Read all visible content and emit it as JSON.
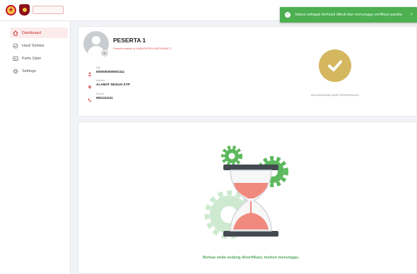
{
  "toast": {
    "message": "Status sebagai berhasil diikuti dan menunggu verifikasi panitia",
    "close": "×"
  },
  "sidebar": {
    "items": [
      {
        "label": "Dashboard",
        "icon": "home-icon"
      },
      {
        "label": "Hasil Seleksi",
        "icon": "check-circle-icon"
      },
      {
        "label": "Kartu Ujian",
        "icon": "id-card-icon"
      },
      {
        "label": "Settings",
        "icon": "gear-icon"
      }
    ],
    "active_index": 0
  },
  "profile": {
    "name": "PESERTA 1",
    "info": "Peserta seleksi di KABUPATEN KARYASAKTI",
    "fields": [
      {
        "label": "NIK",
        "value": "0000000000001111",
        "icon": "user-icon"
      },
      {
        "label": "Alamat",
        "value": "ALAMAT SESUAI KTP",
        "icon": "location-pin-icon"
      },
      {
        "label": "Phone",
        "value": "0811111111",
        "icon": "phone-icon"
      }
    ]
  },
  "status": {
    "text": "KELENGKAPAN DATA TERVERIFIKASI",
    "color": "#d4b75f"
  },
  "waiting": {
    "message": "Berkas anda sedang diverifikasi, mohon menunggu."
  },
  "colors": {
    "accent": "#c62828",
    "success": "#4caf50",
    "gear": "#5cb85c",
    "sand": "#f08a7e"
  }
}
